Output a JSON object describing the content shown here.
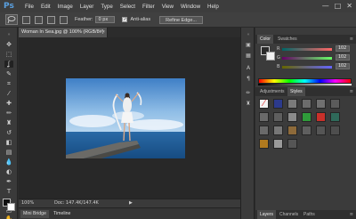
{
  "app": {
    "logo": "Ps"
  },
  "menu": [
    "File",
    "Edit",
    "Image",
    "Layer",
    "Type",
    "Select",
    "Filter",
    "View",
    "Window",
    "Help"
  ],
  "window_controls": {
    "minimize": "—",
    "maximize": "□",
    "close": "✕"
  },
  "options": {
    "feather_label": "Feather:",
    "feather_value": "0 px",
    "anti_alias_label": "Anti-alias",
    "anti_alias_checked": true,
    "refine_edge_label": "Refine Edge..."
  },
  "document": {
    "tab_title": "Woman In Sea.jpg @ 100% (RGB/8#)",
    "close_glyph": "×"
  },
  "status": {
    "zoom": "100%",
    "doc_size": "Doc: 147.4K/147.4K",
    "arrow": "▶"
  },
  "bottom_tabs": [
    "Mini Bridge",
    "Timeline"
  ],
  "panels": {
    "color_tabs": [
      "Color",
      "Swatches"
    ],
    "sliders": [
      {
        "label": "R",
        "value": "102"
      },
      {
        "label": "G",
        "value": "102"
      },
      {
        "label": "B",
        "value": "102"
      }
    ],
    "adjust_tabs": [
      "Adjustments",
      "Styles"
    ],
    "layer_tabs": [
      "Layers",
      "Channels",
      "Paths"
    ],
    "menu_glyph": "≡"
  },
  "colors": {
    "accent": "#5aa0e0",
    "foreground": "#2a2a2a",
    "background": "#f0f0f0"
  },
  "toolbar_icons": [
    "move-icon",
    "marquee-icon",
    "lasso-icon",
    "quick-select-icon",
    "crop-icon",
    "eyedropper-icon",
    "healing-brush-icon",
    "brush-icon",
    "clone-stamp-icon",
    "history-brush-icon",
    "eraser-icon",
    "gradient-icon",
    "blur-icon",
    "dodge-icon",
    "pen-icon",
    "type-icon",
    "path-select-icon",
    "shape-icon",
    "hand-icon",
    "zoom-icon"
  ]
}
